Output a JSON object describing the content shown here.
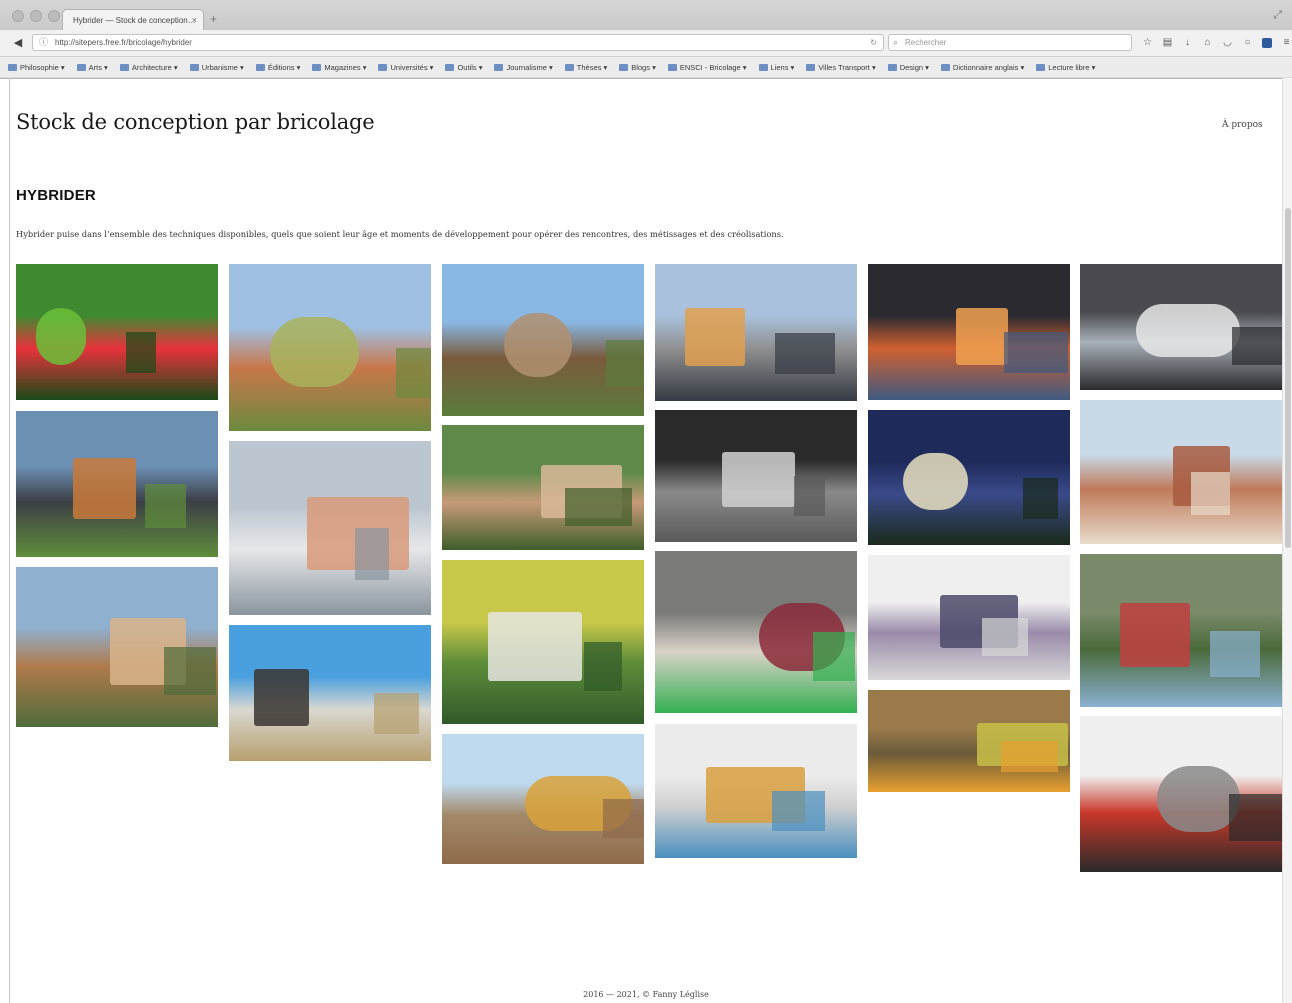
{
  "browser": {
    "tab_title": "Hybrider — Stock de conception…",
    "tab_close": "×",
    "new_tab": "+",
    "url": "http://sitepers.free.fr/bricolage/hybrider",
    "search_placeholder": "Rechercher",
    "bookmarks": [
      "Philosophie",
      "Arts",
      "Architecture",
      "Urbanisme",
      "Éditions",
      "Magazines",
      "Universités",
      "Outils",
      "Journalisme",
      "Thèses",
      "Blogs",
      "ENSCI - Bricolage",
      "Liens",
      "Villes Transport",
      "Design",
      "Dictionnaire anglais",
      "Lecture libre"
    ]
  },
  "site": {
    "title": "Stock de conception par bricolage",
    "about": "À propos",
    "section_title": "HYBRIDER",
    "section_description": "Hybrider puise dans l’ensemble des techniques disponibles, quels que soient leur âge et moments de développement pour opérer des rencontres, des métissages et des créolisations.",
    "footer": "2016 — 2021, © Fanny Léglise"
  },
  "gallery": [
    {
      "name": "photo-colored-columns",
      "colors": [
        "#3f8a30",
        "#e8323c",
        "#6bbf3a",
        "#1a4a18"
      ]
    },
    {
      "name": "photo-modular-housing-block",
      "colors": [
        "#6c8fb4",
        "#3c3f46",
        "#c97a3a",
        "#5f8d3b"
      ]
    },
    {
      "name": "photo-earth-school-tree",
      "colors": [
        "#8fb0cf",
        "#b07a4c",
        "#d9b48a",
        "#4f6b3a"
      ]
    },
    {
      "name": "photo-warka-water-tower",
      "colors": [
        "#9fc0e2",
        "#c8774a",
        "#a8b35c",
        "#6c8a3e"
      ]
    },
    {
      "name": "photo-hand-plastic-object",
      "colors": [
        "#bcc6d0",
        "#e6e8ea",
        "#d99a7a",
        "#8a959e"
      ]
    },
    {
      "name": "photo-sandbag-dome",
      "colors": [
        "#4aa0df",
        "#d9d8d1",
        "#3a3530",
        "#b89f6e"
      ]
    },
    {
      "name": "photo-village-street",
      "colors": [
        "#8ab8e5",
        "#7a5a3c",
        "#b09070",
        "#5b7c3c"
      ]
    },
    {
      "name": "photo-rooftop-workshop",
      "colors": [
        "#5f8a4a",
        "#c79a78",
        "#d8b998",
        "#3f5e2a"
      ]
    },
    {
      "name": "photo-aerial-fields",
      "colors": [
        "#c8c84a",
        "#5f8e3a",
        "#e6e6e0",
        "#2f5a2a"
      ]
    },
    {
      "name": "photo-colorful-hillside",
      "colors": [
        "#bfd9ef",
        "#a38a6a",
        "#d8a23a",
        "#8e6a4a"
      ]
    },
    {
      "name": "photo-curved-building-dusk",
      "colors": [
        "#a9c1dc",
        "#8f8f8f",
        "#e0a050",
        "#343a44"
      ]
    },
    {
      "name": "photo-black-white-crowd",
      "colors": [
        "#2a2a2a",
        "#8a8a8a",
        "#d0d0d0",
        "#5a5a5a"
      ]
    },
    {
      "name": "photo-grid-installation",
      "colors": [
        "#7a7a78",
        "#d9d2c8",
        "#8b2a3a",
        "#33b050"
      ]
    },
    {
      "name": "photo-exhibition-room",
      "colors": [
        "#ececec",
        "#cfcfcf",
        "#d9a040",
        "#4a90c0"
      ]
    },
    {
      "name": "photo-canopy-night",
      "colors": [
        "#2a2a30",
        "#d06030",
        "#f0a050",
        "#3f5a80"
      ]
    },
    {
      "name": "photo-lit-building-night",
      "colors": [
        "#1e2a5a",
        "#3a4a8a",
        "#e8e0c0",
        "#1a2a1a"
      ]
    },
    {
      "name": "photo-sketch-figures",
      "colors": [
        "#efefef",
        "#9a8aaa",
        "#4a4a6a",
        "#d8d8d8"
      ]
    },
    {
      "name": "photo-wooden-wall",
      "colors": [
        "#9a7a4a",
        "#6a5a3a",
        "#c8c048",
        "#e8a030"
      ]
    },
    {
      "name": "photo-aerial-coast",
      "colors": [
        "#4a4a50",
        "#a8b0b8",
        "#e6e6e6",
        "#2a2a2e"
      ]
    },
    {
      "name": "photo-brick-house",
      "colors": [
        "#c8d9e8",
        "#c07a5a",
        "#a85a40",
        "#e8dccb"
      ]
    },
    {
      "name": "photo-aerial-city-park",
      "colors": [
        "#7a8a6a",
        "#4a6a3a",
        "#c04040",
        "#8ab0d0"
      ]
    },
    {
      "name": "photo-red-container-facade",
      "colors": [
        "#f0f0f0",
        "#c8382a",
        "#8a8a8a",
        "#2a2a2a"
      ]
    }
  ]
}
